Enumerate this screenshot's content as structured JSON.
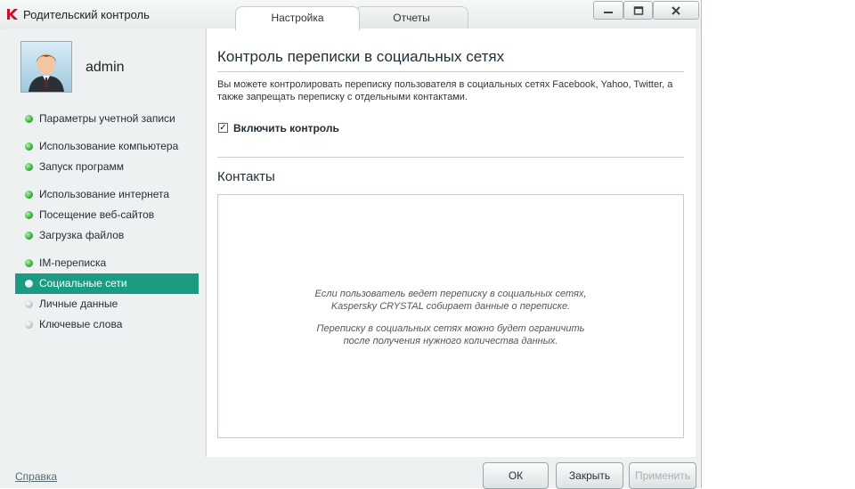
{
  "window": {
    "title": "Родительский контроль",
    "tabs": [
      {
        "label": "Настройка",
        "active": true
      },
      {
        "label": "Отчеты",
        "active": false
      }
    ],
    "brand_color": "#c8102e"
  },
  "sidebar": {
    "username": "admin",
    "items": [
      {
        "label": "Параметры учетной записи",
        "status": "green"
      },
      {
        "label": "Использование компьютера",
        "status": "green"
      },
      {
        "label": "Запуск программ",
        "status": "green"
      },
      {
        "label": "Использование интернета",
        "status": "green"
      },
      {
        "label": "Посещение веб-сайтов",
        "status": "green"
      },
      {
        "label": "Загрузка файлов",
        "status": "green"
      },
      {
        "label": "IM-переписка",
        "status": "green"
      },
      {
        "label": "Социальные сети",
        "status": "active"
      },
      {
        "label": "Личные данные",
        "status": "gray"
      },
      {
        "label": "Ключевые слова",
        "status": "gray"
      }
    ],
    "active_color": "#1b9b82"
  },
  "main": {
    "title": "Контроль переписки в социальных сетях",
    "description": "Вы можете контролировать переписку пользователя в социальных сетях Facebook, Yahoo, Twitter, а также запрещать переписку с отдельными контактами.",
    "enable_control": {
      "label": "Включить контроль",
      "checked": true
    },
    "contacts_title": "Контакты",
    "info_line1": "Если пользователь ведет переписку в социальных сетях,",
    "info_line2": "Kaspersky CRYSTAL собирает данные о переписке.",
    "info_line3": "Переписку в социальных сетях можно будет ограничить",
    "info_line4": "после получения нужного количества данных."
  },
  "footer": {
    "help": "Справка",
    "ok": "ОК",
    "close": "Закрыть",
    "apply": "Применить"
  }
}
